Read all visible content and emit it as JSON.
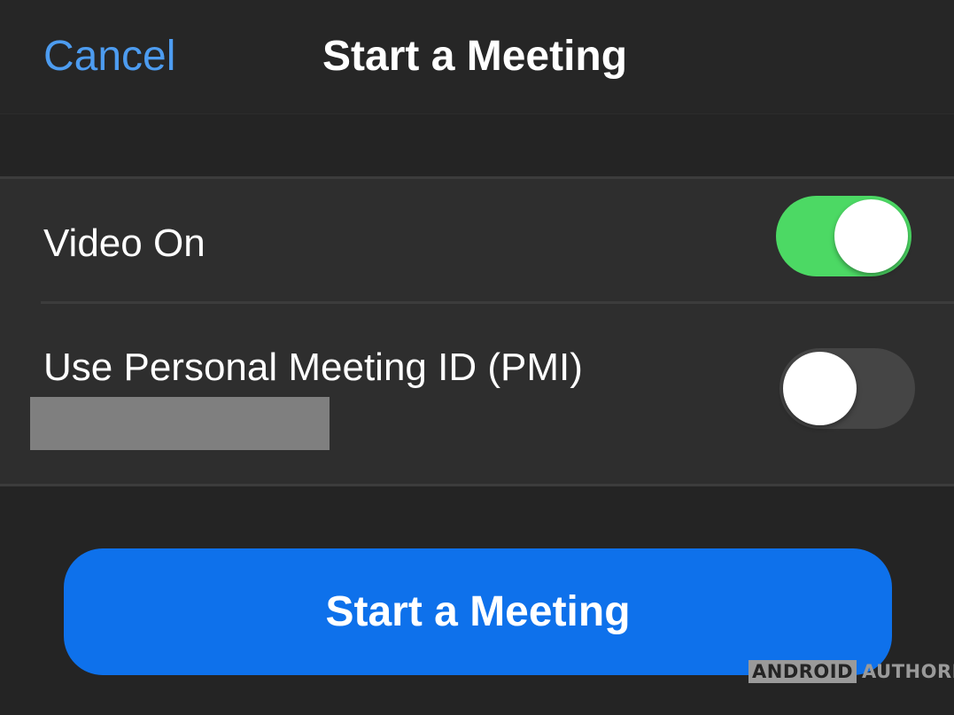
{
  "nav": {
    "cancel_label": "Cancel",
    "title": "Start a Meeting"
  },
  "settings": {
    "video_on": {
      "label": "Video On",
      "enabled": true,
      "toggle_color": "#4cd964"
    },
    "use_pmi": {
      "label": "Use Personal Meeting ID (PMI)",
      "enabled": false,
      "toggle_color": "#454545"
    }
  },
  "start_button": {
    "label": "Start a Meeting",
    "color": "#0e71eb"
  },
  "watermark": {
    "boxed_text": "ANDROID",
    "text": "AUTHORITY"
  },
  "colors": {
    "background": "#242424",
    "link": "#4d9cf0",
    "group_background": "#2e2e2e"
  }
}
